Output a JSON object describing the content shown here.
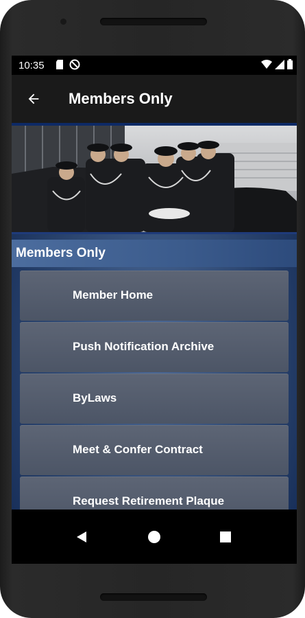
{
  "status_bar": {
    "time": "10:35"
  },
  "app_bar": {
    "title": "Members Only",
    "back_icon": "arrow-back-icon"
  },
  "section": {
    "title": "Members Only"
  },
  "menu": {
    "items": [
      {
        "label": "Member Home"
      },
      {
        "label": "Push Notification Archive"
      },
      {
        "label": "ByLaws"
      },
      {
        "label": "Meet & Confer Contract"
      },
      {
        "label": "Request Retirement Plaque"
      }
    ]
  },
  "nav_bar": {
    "icons": [
      "back-triangle-icon",
      "home-circle-icon",
      "recents-square-icon"
    ]
  },
  "colors": {
    "header_bg": "#1a1a1a",
    "section_header": "#3b5b8c",
    "menu_item": "#525b6b",
    "hero_border": "#1f3b7a"
  }
}
